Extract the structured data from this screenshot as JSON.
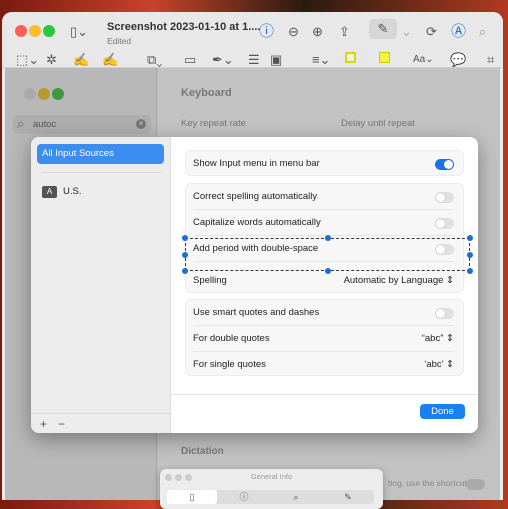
{
  "preview": {
    "title": "Screenshot 2023-01-10 at 1....",
    "subtitle": "Edited"
  },
  "settings": {
    "search_value": "autoc",
    "heading": "Keyboard",
    "key_repeat": "Key repeat rate",
    "delay": "Delay until repeat",
    "dictation": "Dictation",
    "shortcut_text": "ting, use the shortcut"
  },
  "sheet": {
    "sources": [
      {
        "label": "All Input Sources",
        "selected": true
      },
      {
        "label": "U.S.",
        "badge": "A"
      }
    ],
    "add": "+",
    "remove": "−",
    "show_input": {
      "label": "Show Input menu in menu bar",
      "on": true
    },
    "correct": {
      "label": "Correct spelling automatically",
      "on": false
    },
    "capitalize": {
      "label": "Capitalize words automatically",
      "on": false
    },
    "period": {
      "label": "Add period with double-space",
      "on": false
    },
    "spelling": {
      "label": "Spelling",
      "value": "Automatic by Language"
    },
    "smart": {
      "label": "Use smart quotes and dashes",
      "on": false
    },
    "double": {
      "label": "For double quotes",
      "value": "“abc”"
    },
    "single": {
      "label": "For single quotes",
      "value": "‘abc’"
    },
    "done": "Done"
  },
  "info": {
    "title": "General Info"
  },
  "colors": {
    "accent": "#1a73e8",
    "selection": "#1a6fd0"
  }
}
